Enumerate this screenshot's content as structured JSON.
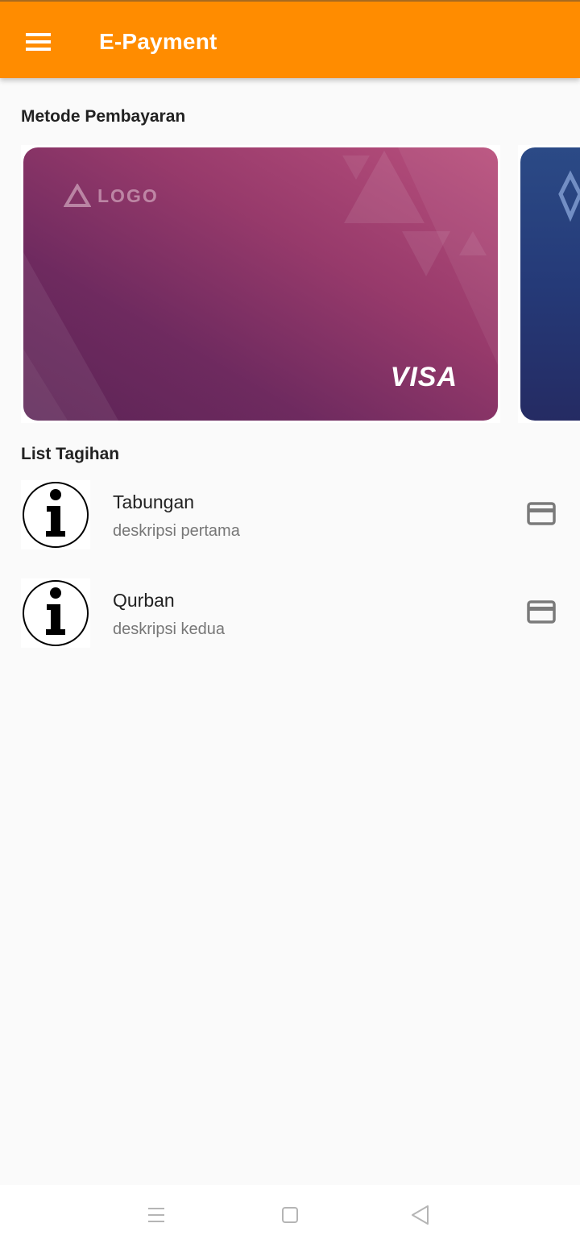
{
  "app_bar": {
    "title": "E-Payment",
    "menu_icon": "hamburger-menu-icon",
    "background_color": "#ff8c00"
  },
  "payment_methods": {
    "heading": "Metode Pembayaran",
    "cards": [
      {
        "logo_text": "LOGO",
        "brand": "VISA",
        "colors": [
          "#b9507d",
          "#5c2456"
        ]
      },
      {
        "colors": [
          "#2b4a86",
          "#252b63"
        ]
      }
    ]
  },
  "bills": {
    "heading": "List Tagihan",
    "items": [
      {
        "title": "Tabungan",
        "subtitle": "deskripsi pertama",
        "leading_icon": "info-icon",
        "trailing_icon": "credit-card-icon"
      },
      {
        "title": "Qurban",
        "subtitle": "deskripsi kedua",
        "leading_icon": "info-icon",
        "trailing_icon": "credit-card-icon"
      }
    ]
  },
  "system_nav": {
    "icons": [
      "recent-apps-icon",
      "home-icon",
      "back-icon"
    ]
  }
}
